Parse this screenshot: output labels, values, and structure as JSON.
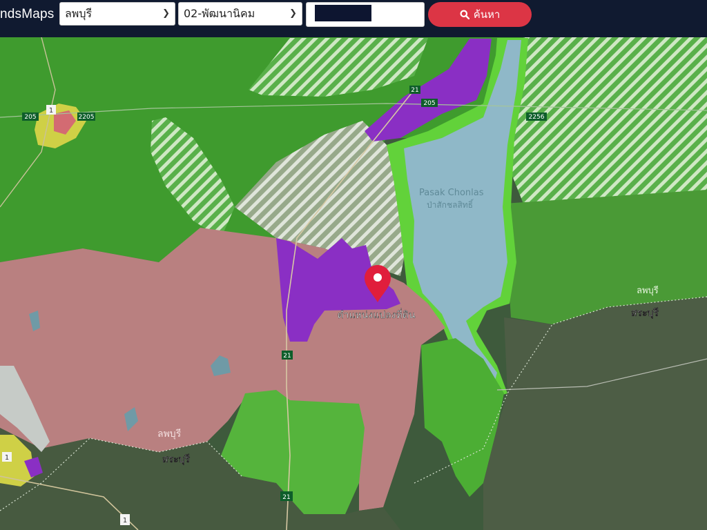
{
  "app": {
    "brand": "ndsMaps"
  },
  "toolbar": {
    "province_select": {
      "value": "ลพบุรี"
    },
    "district_select": {
      "value": "02-พัฒนานิคม"
    },
    "parcel_input": {
      "value": ""
    },
    "search_label": "ค้นหา"
  },
  "icons": {
    "search": "search-icon",
    "chevron": "chevron-down-icon",
    "pin": "map-pin-icon"
  },
  "colors": {
    "topbar": "#101a30",
    "search_button": "#dc3545",
    "pin": "#e01e3c",
    "forest_zone": "#3f9b2e",
    "agri_zone": "#b98080",
    "industrial_zone": "#8a2fc4",
    "water": "#8fb8c8"
  },
  "map": {
    "reservoir_label_en": "Pasak Chonlas",
    "reservoir_label_th": "ป่าสักชลสิทธิ์",
    "marker_label": "ตำแหน่งแปลงที่ดิน",
    "province_labels": {
      "lopburi_east": "ลพบุรี",
      "saraburi_east": "สระบุรี",
      "lopburi_west": "ลพบุรี",
      "saraburi_west": "สระบุรี"
    },
    "road_shields": {
      "r21_top": "21",
      "r205_top": "205",
      "r2256": "2256",
      "r205_left": "205",
      "r2205": "2205",
      "r21_mid": "21",
      "r21_bottom": "21",
      "r1_left": "1",
      "r1_bottom": "1",
      "r1_town": "1"
    }
  }
}
